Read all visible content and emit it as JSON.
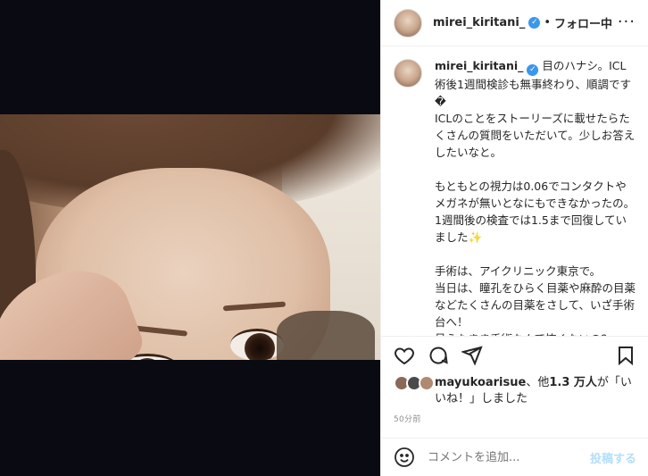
{
  "post": {
    "username": "mirei_kiritani_",
    "verified_icon": "verified-badge-icon",
    "separator": "•",
    "follow_label": "フォロー中",
    "more_icon": "more-horizontal-icon",
    "more_glyph": "···"
  },
  "caption": {
    "username": "mirei_kiritani_",
    "text": "目のハナシ。ICL術後1週間検診も無事終わり、順調です�\nICLのことをストーリーズに載せたらたくさんの質問をいただいて。少しお答えしたいなと。\n\nもともとの視力は0.06でコンタクトやメガネが無いとなにもできなかったの。\n1週間後の検査では1.5まで回復していました✨\n\n手術は、アイクリニック東京で。\n当日は、瞳孔をひらく目薬や麻酔の目薬などたくさんの目薬をさして、いざ手術台へ！\n見えたまま手術なんて怖くないの？って、よく聞かれるし私も思ってたけ"
  },
  "actions": {
    "like_icon": "heart-icon",
    "comment_icon": "comment-icon",
    "share_icon": "share-icon",
    "save_icon": "bookmark-icon"
  },
  "likes": {
    "user": "mayukoarisue",
    "text_mid": "、他",
    "count": "1.3 万人",
    "text_end": "が「いいね！」しました"
  },
  "timestamp": "50分前",
  "comment_box": {
    "emoji_icon": "emoji-icon",
    "placeholder": "コメントを追加...",
    "post_label": "投稿する"
  },
  "colors": {
    "verified": "#3897f0",
    "post_disabled": "#b2dffc",
    "media_bg": "#0a0a12"
  }
}
